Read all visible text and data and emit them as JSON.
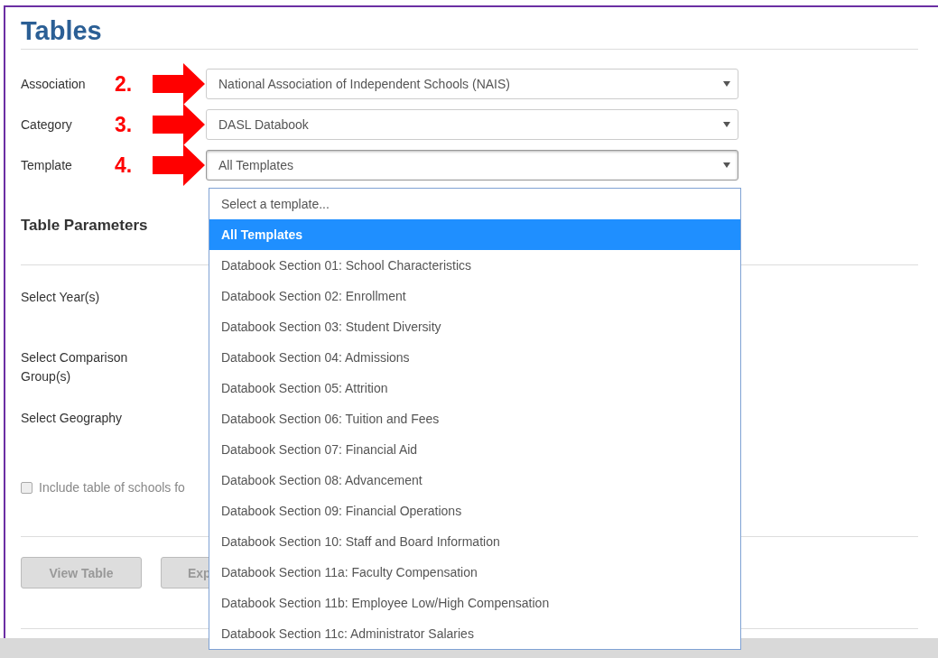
{
  "title": "Tables",
  "fields": [
    {
      "label": "Association",
      "step": "2.",
      "value": "National Association of Independent Schools (NAIS)",
      "focused": false
    },
    {
      "label": "Category",
      "step": "3.",
      "value": "DASL Databook",
      "focused": false
    },
    {
      "label": "Template",
      "step": "4.",
      "value": "All Templates",
      "focused": true
    }
  ],
  "parameters": {
    "heading": "Table Parameters",
    "rows": [
      {
        "label": "Select Year(s)"
      },
      {
        "label": "Select Comparison Group(s)"
      },
      {
        "label": "Select Geography"
      }
    ],
    "checkbox": {
      "label": "Include table of schools fo",
      "checked": false
    }
  },
  "buttons": [
    {
      "label": "View Table",
      "disabled": true
    },
    {
      "label": "Exp",
      "disabled": true
    }
  ],
  "dropdown": {
    "options": [
      {
        "label": "Select a template...",
        "selected": false
      },
      {
        "label": "All Templates",
        "selected": true
      },
      {
        "label": "Databook Section 01: School Characteristics",
        "selected": false
      },
      {
        "label": "Databook Section 02: Enrollment",
        "selected": false
      },
      {
        "label": "Databook Section 03: Student Diversity",
        "selected": false
      },
      {
        "label": "Databook Section 04: Admissions",
        "selected": false
      },
      {
        "label": "Databook Section 05: Attrition",
        "selected": false
      },
      {
        "label": "Databook Section 06: Tuition and Fees",
        "selected": false
      },
      {
        "label": "Databook Section 07: Financial Aid",
        "selected": false
      },
      {
        "label": "Databook Section 08: Advancement",
        "selected": false
      },
      {
        "label": "Databook Section 09: Financial Operations",
        "selected": false
      },
      {
        "label": "Databook Section 10: Staff and Board Information",
        "selected": false
      },
      {
        "label": "Databook Section 11a: Faculty Compensation",
        "selected": false
      },
      {
        "label": "Databook Section 11b: Employee Low/High Compensation",
        "selected": false
      },
      {
        "label": "Databook Section 11c: Administrator Salaries",
        "selected": false
      }
    ]
  }
}
